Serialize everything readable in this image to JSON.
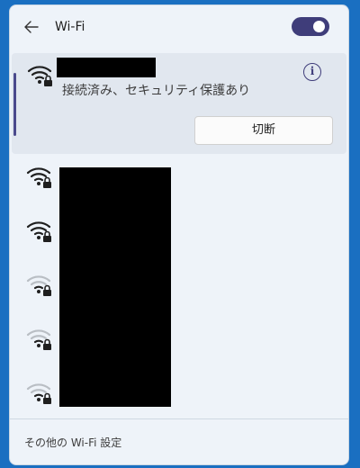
{
  "header": {
    "title": "Wi-Fi",
    "back_icon": "arrow-left-icon",
    "toggle_state": "on"
  },
  "connected_network": {
    "status": "接続済み、セキュリティ保護あり",
    "info_icon_glyph": "i",
    "disconnect_label": "切断",
    "signal_strength": "full",
    "secured": true
  },
  "networks": [
    {
      "signal_strength": "full",
      "secured": true
    },
    {
      "signal_strength": "full",
      "secured": true
    },
    {
      "signal_strength": "weak",
      "secured": true
    },
    {
      "signal_strength": "weak",
      "secured": true
    },
    {
      "signal_strength": "weak",
      "secured": true
    }
  ],
  "footer": {
    "more_settings_label": "その他の Wi-Fi 設定"
  },
  "colors": {
    "accent": "#3f3d7a",
    "panel_bg": "#eef3f9",
    "selected_bg": "#e1e7ef",
    "desktop_bg": "#1a6fc1"
  }
}
